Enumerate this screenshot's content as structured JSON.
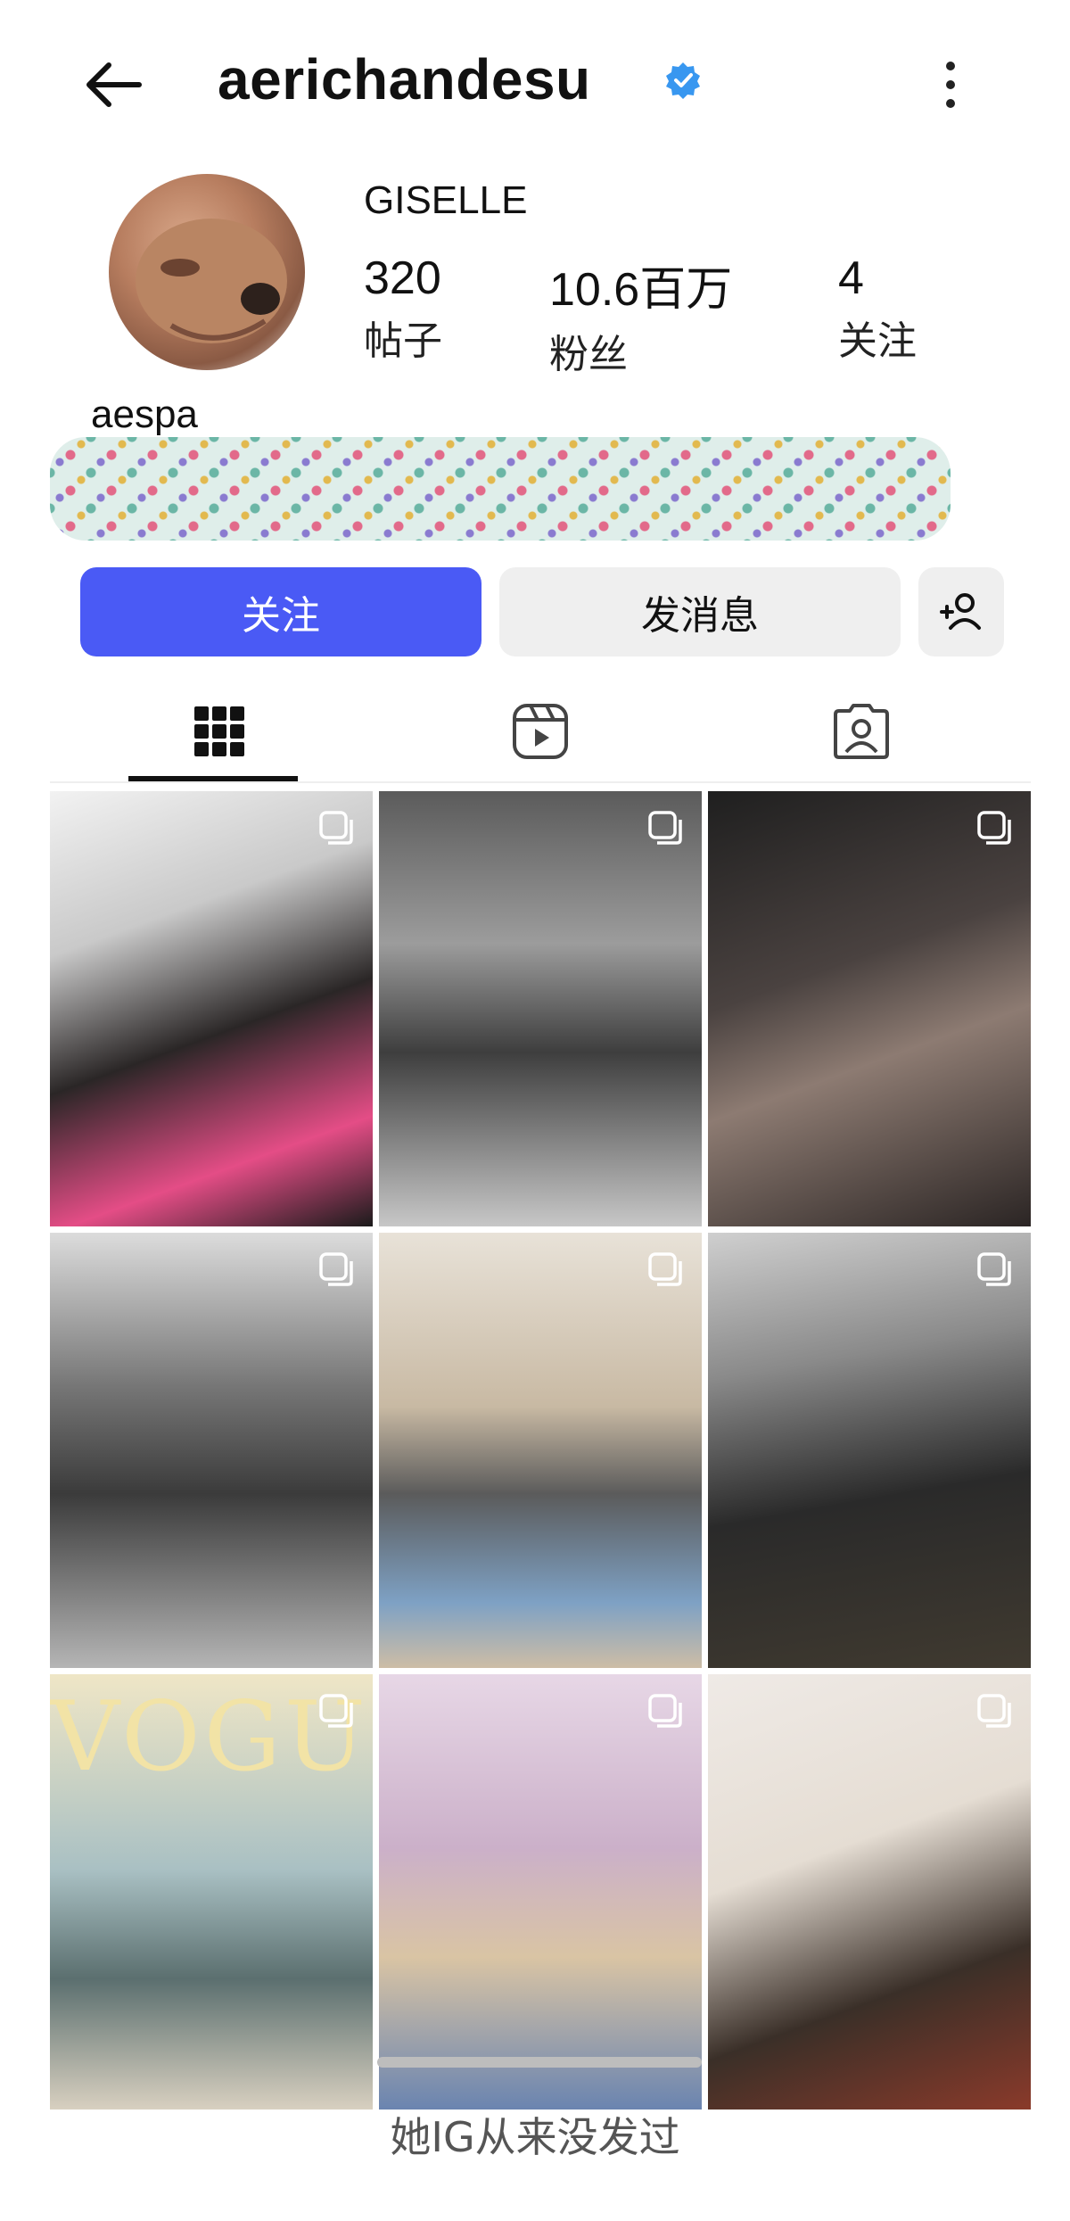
{
  "header": {
    "username": "aerichandesu",
    "back_icon": "arrow-left-icon",
    "verified_icon": "verified-badge-icon",
    "more_icon": "more-vertical-icon"
  },
  "profile": {
    "display_name": "GISELLE",
    "stats": [
      {
        "value": "320",
        "label": "帖子"
      },
      {
        "value": "10.6百万",
        "label": "粉丝"
      },
      {
        "value": "4",
        "label": "关注"
      }
    ],
    "bio": "aespa"
  },
  "actions": {
    "follow": "关注",
    "message": "发消息",
    "add_icon": "add-person-icon"
  },
  "tabs": [
    {
      "icon": "grid-icon",
      "active": true
    },
    {
      "icon": "reels-icon",
      "active": false
    },
    {
      "icon": "tagged-icon",
      "active": false
    }
  ],
  "posts": {
    "vogue_cover_text": "VOGUE"
  },
  "caption": "她IG从来没发过",
  "colors": {
    "follow_button": "#4a5af5",
    "secondary_button": "#efefef",
    "verified": "#3897f0"
  }
}
